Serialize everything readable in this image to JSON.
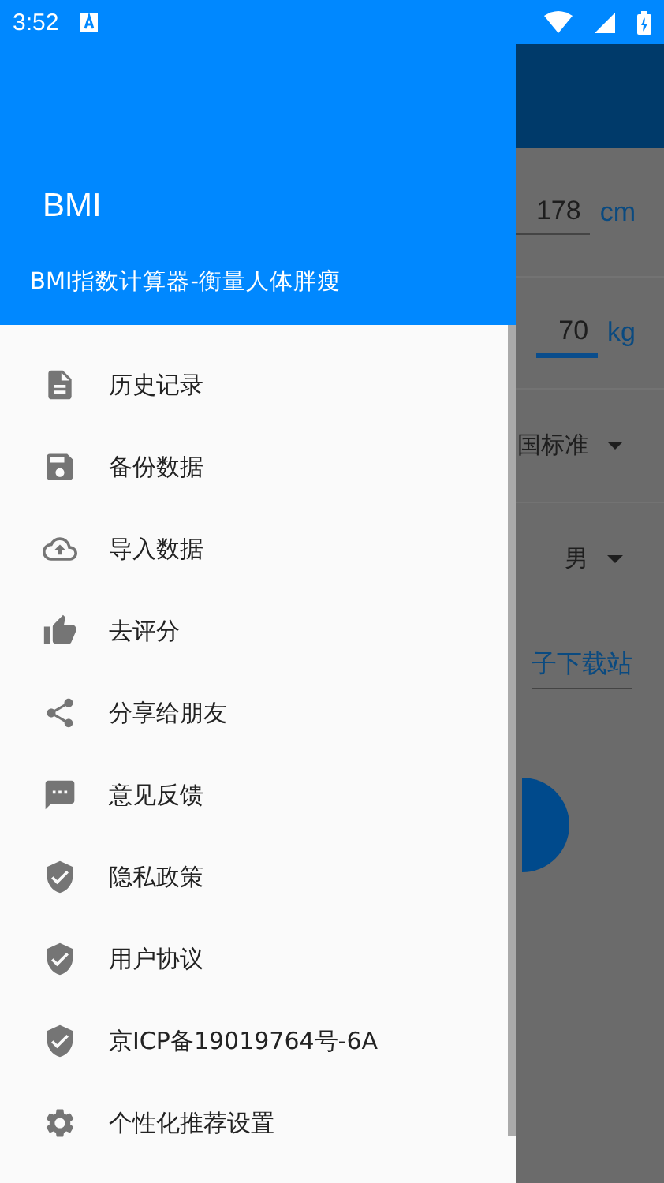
{
  "status_bar": {
    "time": "3:52"
  },
  "drawer": {
    "title": "BMI",
    "subtitle": "BMI指数计算器-衡量人体胖瘦",
    "items": [
      {
        "label": "历史记录",
        "kind": "document"
      },
      {
        "label": "备份数据",
        "kind": "save"
      },
      {
        "label": "导入数据",
        "kind": "upload"
      },
      {
        "label": "去评分",
        "kind": "thumb"
      },
      {
        "label": "分享给朋友",
        "kind": "share"
      },
      {
        "label": "意见反馈",
        "kind": "chat"
      },
      {
        "label": "隐私政策",
        "kind": "shield"
      },
      {
        "label": "用户协议",
        "kind": "shield"
      },
      {
        "label": "京ICP备19019764号-6A",
        "kind": "shield"
      },
      {
        "label": "个性化推荐设置",
        "kind": "gear"
      }
    ]
  },
  "background": {
    "height": {
      "value": "178",
      "unit": "cm",
      "focused": false
    },
    "weight": {
      "value": "70",
      "unit": "kg",
      "focused": true
    },
    "standard": "国标准",
    "gender": "男",
    "link": "子下载站"
  }
}
